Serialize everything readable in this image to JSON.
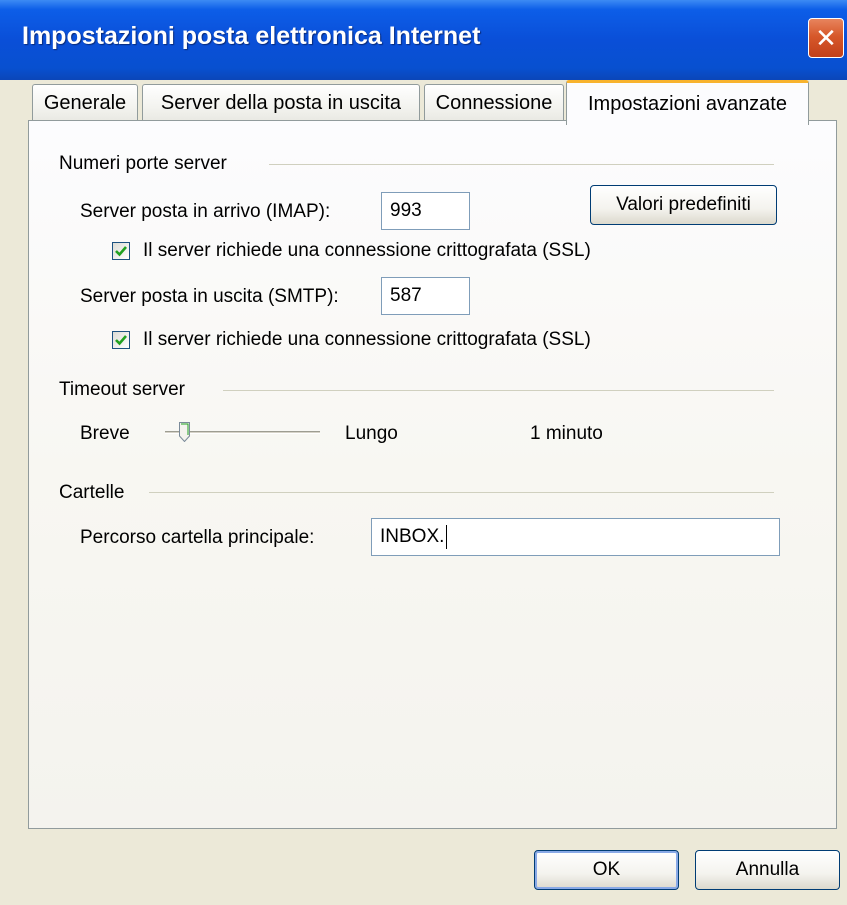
{
  "window": {
    "title": "Impostazioni posta elettronica Internet"
  },
  "tabs": [
    {
      "label": "Generale"
    },
    {
      "label": "Server della posta in uscita"
    },
    {
      "label": "Connessione"
    },
    {
      "label": "Impostazioni avanzate"
    }
  ],
  "active_tab": "Impostazioni avanzate",
  "server_ports": {
    "title": "Numeri porte server",
    "incoming_label": "Server posta in arrivo (IMAP):",
    "incoming_value": "993",
    "incoming_ssl_label": "Il server richiede una connessione crittografata (SSL)",
    "incoming_ssl_checked": true,
    "outgoing_label": "Server posta in uscita (SMTP):",
    "outgoing_value": "587",
    "outgoing_ssl_label": "Il server richiede una connessione crittografata (SSL)",
    "outgoing_ssl_checked": true,
    "defaults_button": "Valori predefiniti"
  },
  "timeout": {
    "title": "Timeout server",
    "short_label": "Breve",
    "long_label": "Lungo",
    "value_text": "1 minuto",
    "slider_level": 0.1
  },
  "folders": {
    "title": "Cartelle",
    "root_path_label": "Percorso cartella principale:",
    "root_path_value": "INBOX."
  },
  "buttons": {
    "ok": "OK",
    "cancel": "Annulla"
  },
  "colors": {
    "titlebar": "#0a4fd8",
    "close": "#d7582a",
    "active_tab_accent": "#f8b32e",
    "check": "#21a121"
  },
  "icons": {
    "close": "close-icon",
    "checkmark": "checkmark-icon",
    "slider_thumb": "slider-thumb-icon"
  }
}
